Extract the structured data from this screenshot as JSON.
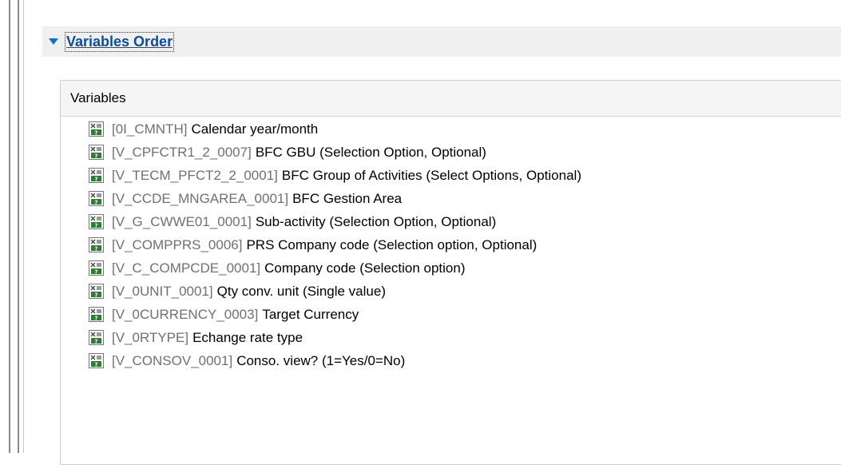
{
  "section": {
    "title": "Variables Order"
  },
  "panel": {
    "header": "Variables"
  },
  "variables": [
    {
      "id": "[0I_CMNTH]",
      "desc": "Calendar year/month"
    },
    {
      "id": "[V_CPFCTR1_2_0007]",
      "desc": "BFC GBU (Selection Option, Optional)"
    },
    {
      "id": "[V_TECM_PFCT2_2_0001]",
      "desc": "BFC Group of Activities (Select Options, Optional)"
    },
    {
      "id": "[V_CCDE_MNGAREA_0001]",
      "desc": "BFC Gestion Area"
    },
    {
      "id": "[V_G_CWWE01_0001]",
      "desc": "Sub-activity (Selection Option, Optional)"
    },
    {
      "id": "[V_COMPPRS_0006]",
      "desc": "PRS Company code (Selection option, Optional)"
    },
    {
      "id": "[V_C_COMPCDE_0001]",
      "desc": "Company code (Selection option)"
    },
    {
      "id": "[V_0UNIT_0001]",
      "desc": "Qty conv. unit (Single value)"
    },
    {
      "id": "[V_0CURRENCY_0003]",
      "desc": "Target Currency"
    },
    {
      "id": "[V_0RTYPE]",
      "desc": "Echange rate type"
    },
    {
      "id": "[V_CONSOV_0001]",
      "desc": "Conso. view? (1=Yes/0=No)"
    }
  ],
  "icons": {
    "variable": "variable-icon",
    "toggle": "triangle-down-icon"
  },
  "colors": {
    "link": "#0b4ea2",
    "toggle": "#1a6fc4",
    "id_text": "#707070"
  }
}
